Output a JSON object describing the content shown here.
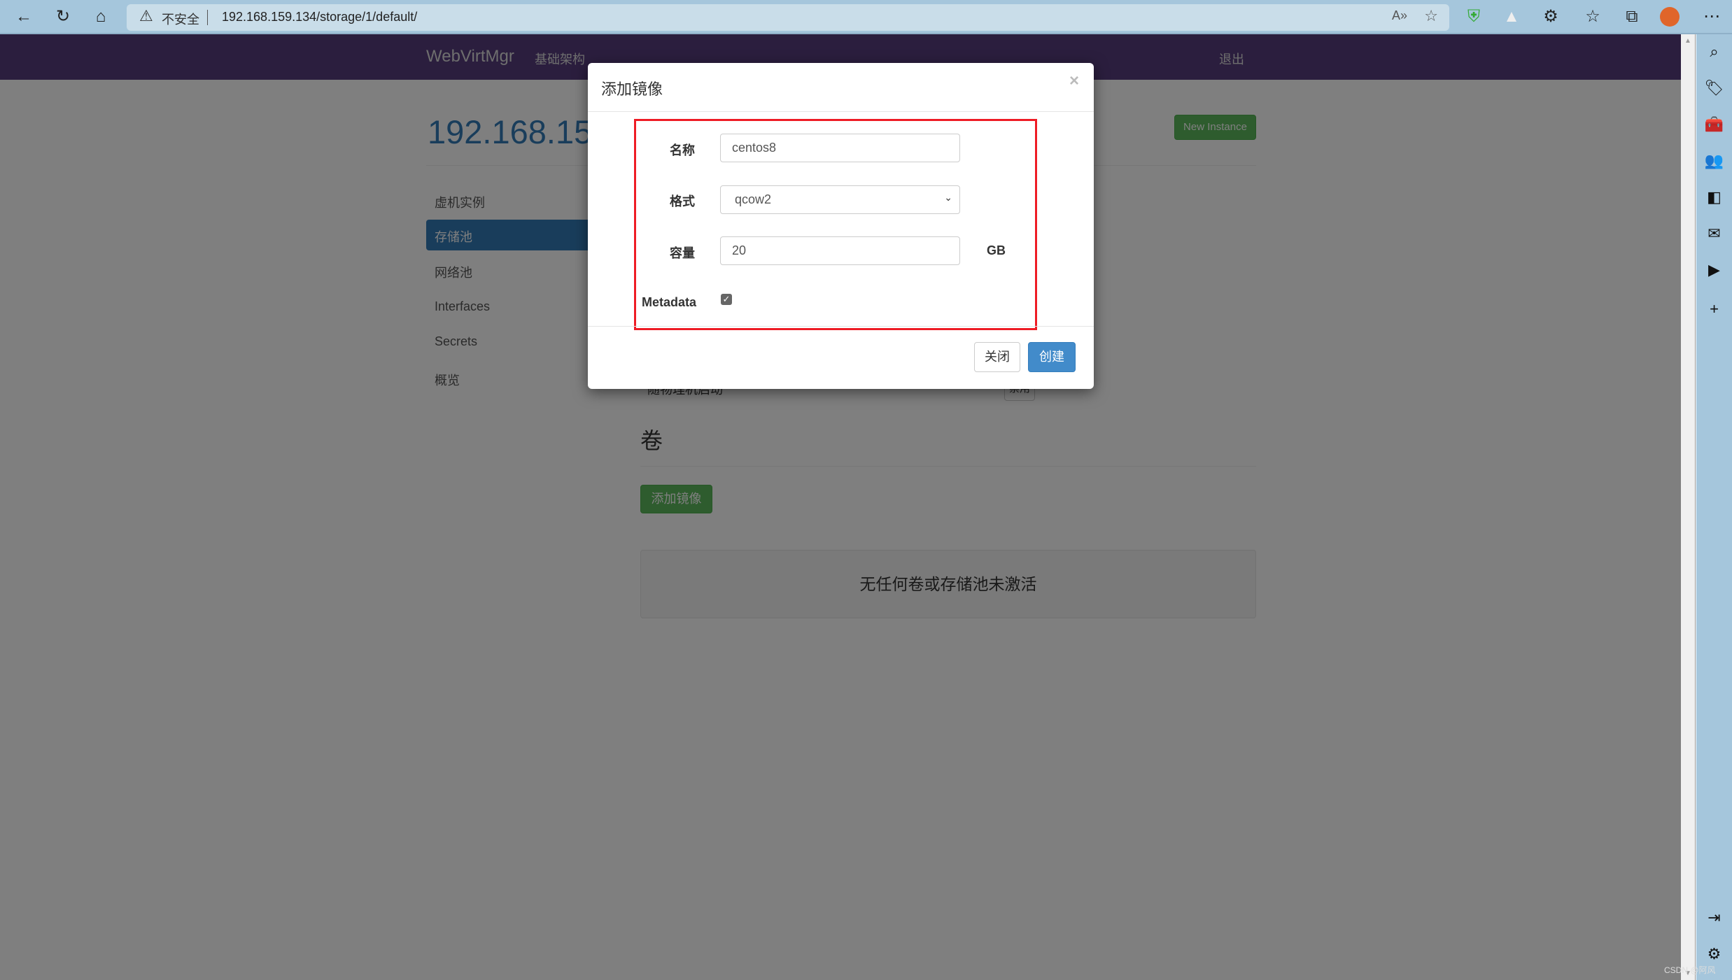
{
  "browser": {
    "warning_label": "不安全",
    "url": "192.168.159.134/storage/1/default/"
  },
  "navbar": {
    "brand": "WebVirtMgr",
    "infrastructure": "基础架构",
    "logout": "退出"
  },
  "page": {
    "title": "192.168.159.134",
    "new_instance": "New Instance",
    "sidebar": [
      {
        "label": "虚机实例"
      },
      {
        "label": "存储池",
        "active": true
      },
      {
        "label": "网络池"
      },
      {
        "label": "Interfaces"
      },
      {
        "label": "Secrets"
      },
      {
        "label": "概览"
      }
    ],
    "partial_text": "y",
    "autostart_label": "随物理机启动",
    "autostart_button": "禁用",
    "volumes_heading": "卷",
    "add_image_button": "添加镜像",
    "empty_message": "无任何卷或存储池未激活"
  },
  "modal": {
    "title": "添加镜像",
    "close_symbol": "×",
    "name_label": "名称",
    "name_value": "centos8",
    "format_label": "格式",
    "format_value": "qcow2",
    "capacity_label": "容量",
    "capacity_value": "20",
    "capacity_unit": "GB",
    "metadata_label": "Metadata",
    "metadata_checked": true,
    "close_button": "关闭",
    "create_button": "创建",
    "highlight_color": "#ee1c25"
  },
  "watermark": "CSDN @阿风"
}
